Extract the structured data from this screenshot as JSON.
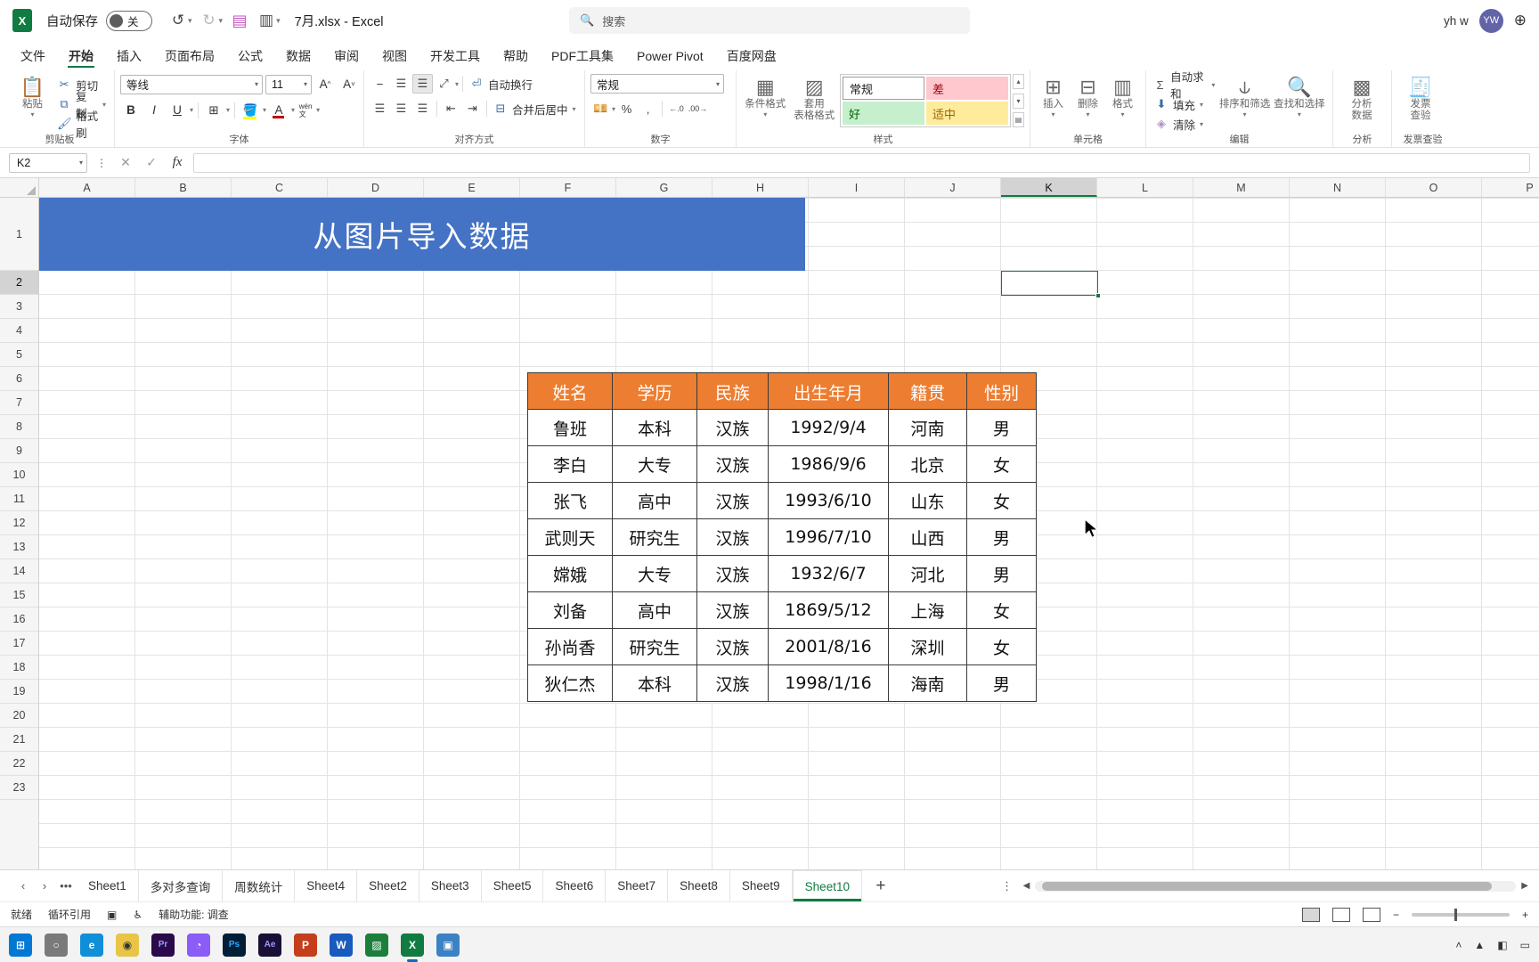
{
  "titlebar": {
    "app_icon": "excel-icon",
    "autosave_label": "自动保存",
    "autosave_state": "关",
    "undo_icon": "undo-icon",
    "redo_icon": "redo-icon",
    "save_icon": "save-icon",
    "touch_icon": "touch-mode-icon",
    "customize_icon": "chevron-down-icon",
    "document_title": "7月.xlsx  -  Excel",
    "search_placeholder": "搜索",
    "search_icon": "search-icon",
    "user_name": "yh w",
    "avatar_initials": "YW",
    "globe_icon": "globe-icon"
  },
  "tabs": [
    {
      "label": "文件",
      "active": false
    },
    {
      "label": "开始",
      "active": true
    },
    {
      "label": "插入",
      "active": false
    },
    {
      "label": "页面布局",
      "active": false
    },
    {
      "label": "公式",
      "active": false
    },
    {
      "label": "数据",
      "active": false
    },
    {
      "label": "审阅",
      "active": false
    },
    {
      "label": "视图",
      "active": false
    },
    {
      "label": "开发工具",
      "active": false
    },
    {
      "label": "帮助",
      "active": false
    },
    {
      "label": "PDF工具集",
      "active": false
    },
    {
      "label": "Power Pivot",
      "active": false
    },
    {
      "label": "百度网盘",
      "active": false
    }
  ],
  "ribbon": {
    "clipboard": {
      "group_name": "剪贴板",
      "paste": "粘贴",
      "cut": "剪切",
      "copy": "复制",
      "format_painter": "格式刷"
    },
    "font": {
      "group_name": "字体",
      "font_family": "等线",
      "font_size": "11",
      "grow_font": "A",
      "shrink_font": "A",
      "bold": "B",
      "italic": "I",
      "underline": "U",
      "borders": "borders-icon",
      "fill_color": "fill-color-icon",
      "font_color": "font-color-icon",
      "phonetic": "wén\n文"
    },
    "alignment": {
      "group_name": "对齐方式",
      "wrap_text": "自动换行",
      "merge_center": "合并后居中",
      "orientation": "orientation-icon",
      "indent_dec": "decrease-indent-icon",
      "indent_inc": "increase-indent-icon"
    },
    "number": {
      "group_name": "数字",
      "format": "常规",
      "accounting": "accounting-icon",
      "percent": "%",
      "comma": ",",
      "dec_increase": "increase-decimal-icon",
      "dec_decrease": "decrease-decimal-icon"
    },
    "styles": {
      "group_name": "样式",
      "conditional": "条件格式",
      "table_format": "套用\n表格格式",
      "cell_styles": [
        "常规",
        "差",
        "好",
        "适中"
      ]
    },
    "cells": {
      "group_name": "单元格",
      "insert": "插入",
      "delete": "删除",
      "format": "格式"
    },
    "editing": {
      "group_name": "编辑",
      "autosum": "自动求和",
      "fill": "填充",
      "clear": "清除",
      "sort_filter": "排序和筛选",
      "find_select": "查找和选择"
    },
    "analysis": {
      "group_name": "分析",
      "analyze_data": "分析\n数据"
    },
    "invoice": {
      "group_name": "发票查验",
      "invoice_check": "发票\n查验"
    }
  },
  "formula_bar": {
    "name_box": "K2",
    "cancel_icon": "cancel-icon",
    "confirm_icon": "confirm-icon",
    "fx_icon": "fx",
    "formula_value": ""
  },
  "grid": {
    "columns": [
      "A",
      "B",
      "C",
      "D",
      "E",
      "F",
      "G",
      "H",
      "I",
      "J",
      "K",
      "L",
      "M",
      "N",
      "O",
      "P"
    ],
    "selected_column": "K",
    "rows": [
      "1",
      "2",
      "3",
      "4",
      "5",
      "6",
      "7",
      "8",
      "9",
      "10",
      "11",
      "12",
      "13",
      "14",
      "15",
      "16",
      "17",
      "18",
      "19",
      "20",
      "21",
      "22",
      "23"
    ],
    "selected_row": "2",
    "banner_text": "从图片导入数据",
    "banner_color": "#4472c4",
    "selected_cell": "K2"
  },
  "image_table": {
    "header_color": "#ed7d31",
    "headers": [
      "姓名",
      "学历",
      "民族",
      "出生年月",
      "籍贯",
      "性别"
    ],
    "rows": [
      [
        "鲁班",
        "本科",
        "汉族",
        "1992/9/4",
        "河南",
        "男"
      ],
      [
        "李白",
        "大专",
        "汉族",
        "1986/9/6",
        "北京",
        "女"
      ],
      [
        "张飞",
        "高中",
        "汉族",
        "1993/6/10",
        "山东",
        "女"
      ],
      [
        "武则天",
        "研究生",
        "汉族",
        "1996/7/10",
        "山西",
        "男"
      ],
      [
        "嫦娥",
        "大专",
        "汉族",
        "1932/6/7",
        "河北",
        "男"
      ],
      [
        "刘备",
        "高中",
        "汉族",
        "1869/5/12",
        "上海",
        "女"
      ],
      [
        "孙尚香",
        "研究生",
        "汉族",
        "2001/8/16",
        "深圳",
        "女"
      ],
      [
        "狄仁杰",
        "本科",
        "汉族",
        "1998/1/16",
        "海南",
        "男"
      ]
    ]
  },
  "sheet_tabs": {
    "prev_icon": "chevron-left-icon",
    "next_icon": "chevron-right-icon",
    "more_icon": "ellipsis-icon",
    "sheets": [
      "Sheet1",
      "多对多查询",
      "周数统计",
      "Sheet4",
      "Sheet2",
      "Sheet3",
      "Sheet5",
      "Sheet6",
      "Sheet7",
      "Sheet8",
      "Sheet9",
      "Sheet10"
    ],
    "active_sheet": "Sheet10",
    "add_sheet": "+",
    "options_icon": "vertical-ellipsis-icon"
  },
  "status_bar": {
    "state": "就绪",
    "circular_ref": "循环引用",
    "macro_icon": "record-macro-icon",
    "accessibility": "辅助功能: 调查",
    "normal_view": "normal-view-icon",
    "layout_view": "page-layout-icon",
    "break_view": "page-break-icon",
    "zoom_level": ""
  },
  "taskbar": {
    "items": [
      {
        "name": "start-icon",
        "glyph": "⊞",
        "color": "#0078d4",
        "active": false
      },
      {
        "name": "search-icon",
        "glyph": "○",
        "color": "#5a5a5a",
        "active": false
      },
      {
        "name": "edge-icon",
        "glyph": "e",
        "color": "#0f8fd8",
        "active": false
      },
      {
        "name": "chrome-icon",
        "glyph": "◉",
        "color": "#e8c547",
        "active": false
      },
      {
        "name": "premiere-icon",
        "glyph": "Pr",
        "color": "#2a0a4a",
        "active": false
      },
      {
        "name": "app-icon",
        "glyph": "◔",
        "color": "#8b5cf6",
        "active": false
      },
      {
        "name": "photoshop-icon",
        "glyph": "Ps",
        "color": "#001e36",
        "active": false
      },
      {
        "name": "aftereffects-icon",
        "glyph": "Ae",
        "color": "#1a1036",
        "active": false
      },
      {
        "name": "powerpoint-icon",
        "glyph": "P",
        "color": "#c43e1c",
        "active": false
      },
      {
        "name": "word-icon",
        "glyph": "W",
        "color": "#185abd",
        "active": false
      },
      {
        "name": "camtasia-icon",
        "glyph": "▨",
        "color": "#1b7f3b",
        "active": false
      },
      {
        "name": "excel-taskbar-icon",
        "glyph": "X",
        "color": "#107c41",
        "active": true
      },
      {
        "name": "store-icon",
        "glyph": "▣",
        "color": "#3b82c4",
        "active": false
      }
    ],
    "tray_up_icon": "chevron-up-icon",
    "network_icon": "wifi-icon",
    "volume_icon": "volume-icon",
    "battery_icon": "battery-icon"
  }
}
